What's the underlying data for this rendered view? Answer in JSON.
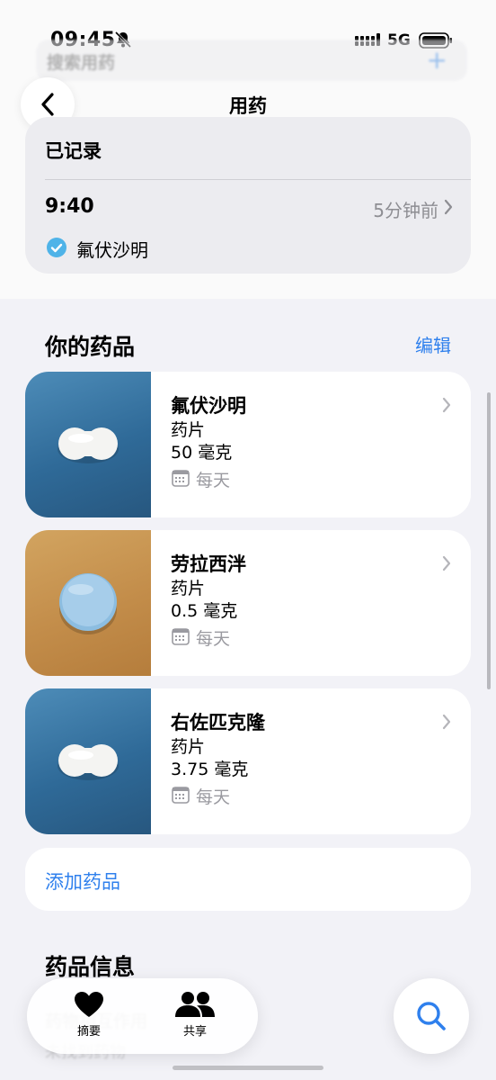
{
  "status_bar": {
    "time": "09:45",
    "network": "5G"
  },
  "ghost_search": {
    "placeholder": "搜索用药"
  },
  "nav": {
    "title": "用药"
  },
  "logged": {
    "title": "已记录",
    "time": "9:40",
    "ago": "5分钟前",
    "med": "氟伏沙明"
  },
  "your_meds": {
    "title": "你的药品",
    "edit_label": "编辑",
    "items": [
      {
        "name": "氟伏沙明",
        "form": "药片",
        "dose": "50 毫克",
        "schedule": "每天",
        "pill": "capsule-white",
        "bg": "#3a78a8"
      },
      {
        "name": "劳拉西泮",
        "form": "药片",
        "dose": "0.5 毫克",
        "schedule": "每天",
        "pill": "round-blue",
        "bg": "#c99650"
      },
      {
        "name": "右佐匹克隆",
        "form": "药片",
        "dose": "3.75 毫克",
        "schedule": "每天",
        "pill": "capsule-white",
        "bg": "#3a78a8"
      }
    ]
  },
  "add_med": {
    "label": "添加药品"
  },
  "med_info": {
    "title": "药品信息",
    "ghost_line1": "药物相互作用",
    "ghost_line2": "未找到药物"
  },
  "tab_bar": {
    "tabs": [
      {
        "label": "摘要",
        "icon": "heart-icon"
      },
      {
        "label": "共享",
        "icon": "people-icon"
      }
    ]
  },
  "search_fab": {
    "icon": "search-icon"
  },
  "colors": {
    "accent": "#2f80ed",
    "check": "#4fb3e8",
    "secondary_text": "#8e8e93"
  }
}
